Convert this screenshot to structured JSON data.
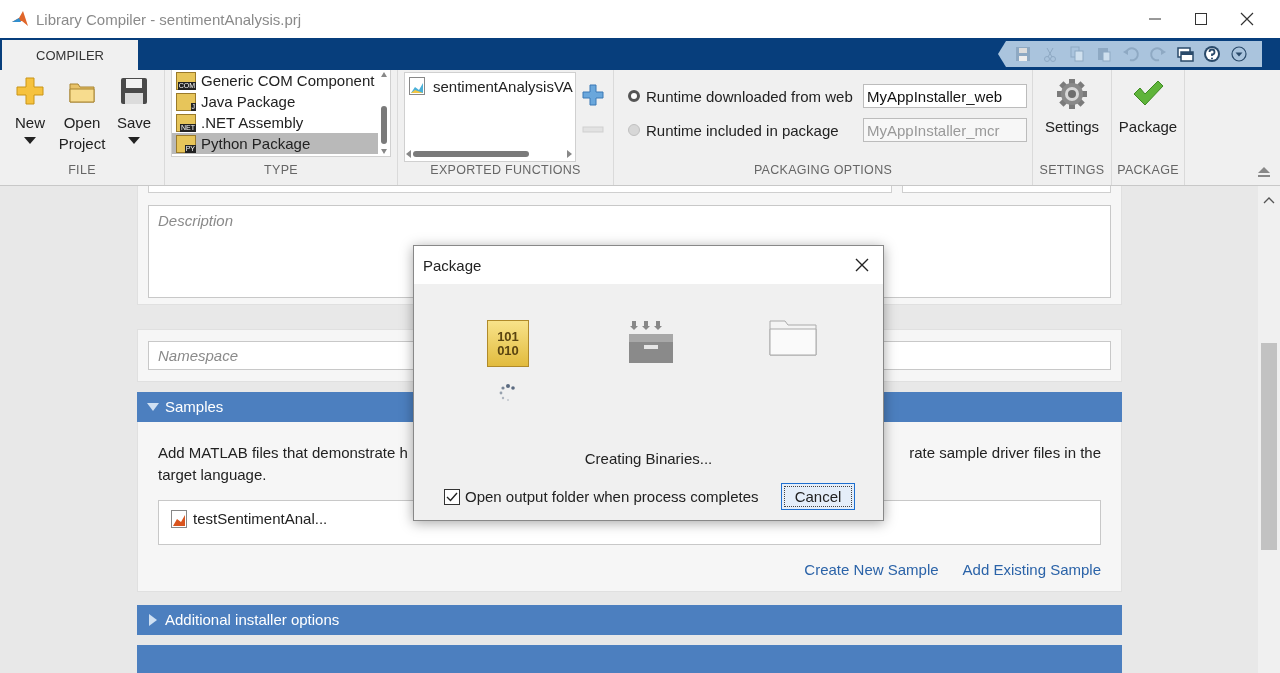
{
  "window": {
    "title": "Library Compiler - sentimentAnalysis.prj"
  },
  "tabs": [
    {
      "label": "COMPILER",
      "selected": true
    }
  ],
  "quick_access": [
    {
      "kind": "save",
      "disabled": true
    },
    {
      "kind": "cut",
      "disabled": true
    },
    {
      "kind": "copy",
      "disabled": true
    },
    {
      "kind": "paste",
      "disabled": true
    },
    {
      "kind": "undo",
      "disabled": true
    },
    {
      "kind": "redo",
      "disabled": true
    },
    {
      "kind": "layout",
      "disabled": false
    },
    {
      "kind": "help",
      "disabled": false
    },
    {
      "kind": "more",
      "disabled": false
    }
  ],
  "ribbon": {
    "file": {
      "label": "FILE",
      "buttons": [
        {
          "kind": "new",
          "label": "New",
          "dropdown": true
        },
        {
          "kind": "open",
          "label": "Open Project",
          "dropdown": false
        },
        {
          "kind": "save",
          "label": "Save",
          "dropdown": true
        }
      ]
    },
    "type": {
      "label": "TYPE",
      "items": [
        {
          "label": "Generic COM Component",
          "badge": "COM",
          "selected": false
        },
        {
          "label": "Java Package",
          "badge": "J",
          "selected": false
        },
        {
          "label": ".NET Assembly",
          "badge": "NET",
          "selected": false
        },
        {
          "label": "Python Package",
          "badge": "PY",
          "selected": true
        }
      ]
    },
    "exported_functions": {
      "label": "EXPORTED FUNCTIONS",
      "items": [
        "sentimentAnalysisVA"
      ]
    },
    "packaging_options": {
      "label": "PACKAGING OPTIONS",
      "options": [
        {
          "label": "Runtime downloaded from web",
          "selected": true,
          "value": "MyAppInstaller_web",
          "disabled": false
        },
        {
          "label": "Runtime included in package",
          "selected": false,
          "value": "MyAppInstaller_mcr",
          "disabled": true
        }
      ]
    },
    "settings": {
      "label": "SETTINGS",
      "button": "Settings"
    },
    "package": {
      "label": "PACKAGE",
      "button": "Package"
    }
  },
  "content": {
    "description": {
      "placeholder": "Description"
    },
    "namespace": {
      "placeholder": "Namespace"
    },
    "samples": {
      "title": "Samples",
      "expanded": true,
      "text_left": "Add MATLAB files that demonstrate h",
      "text_right": "rate sample driver files in the",
      "text_line2": "target language.",
      "files": [
        "testSentimentAnal..."
      ],
      "links": [
        "Create New Sample",
        "Add Existing Sample"
      ]
    },
    "sections": [
      {
        "title": "Additional installer options",
        "expanded": false
      }
    ]
  },
  "dialog": {
    "title": "Package",
    "steps": [
      {
        "kind": "binary",
        "lines": [
          "101",
          "010"
        ],
        "busy": true
      },
      {
        "kind": "archive",
        "busy": false
      },
      {
        "kind": "folder",
        "busy": false
      }
    ],
    "status": "Creating Binaries...",
    "checkbox": {
      "label": "Open output folder when process completes",
      "checked": true
    },
    "button": "Cancel"
  }
}
